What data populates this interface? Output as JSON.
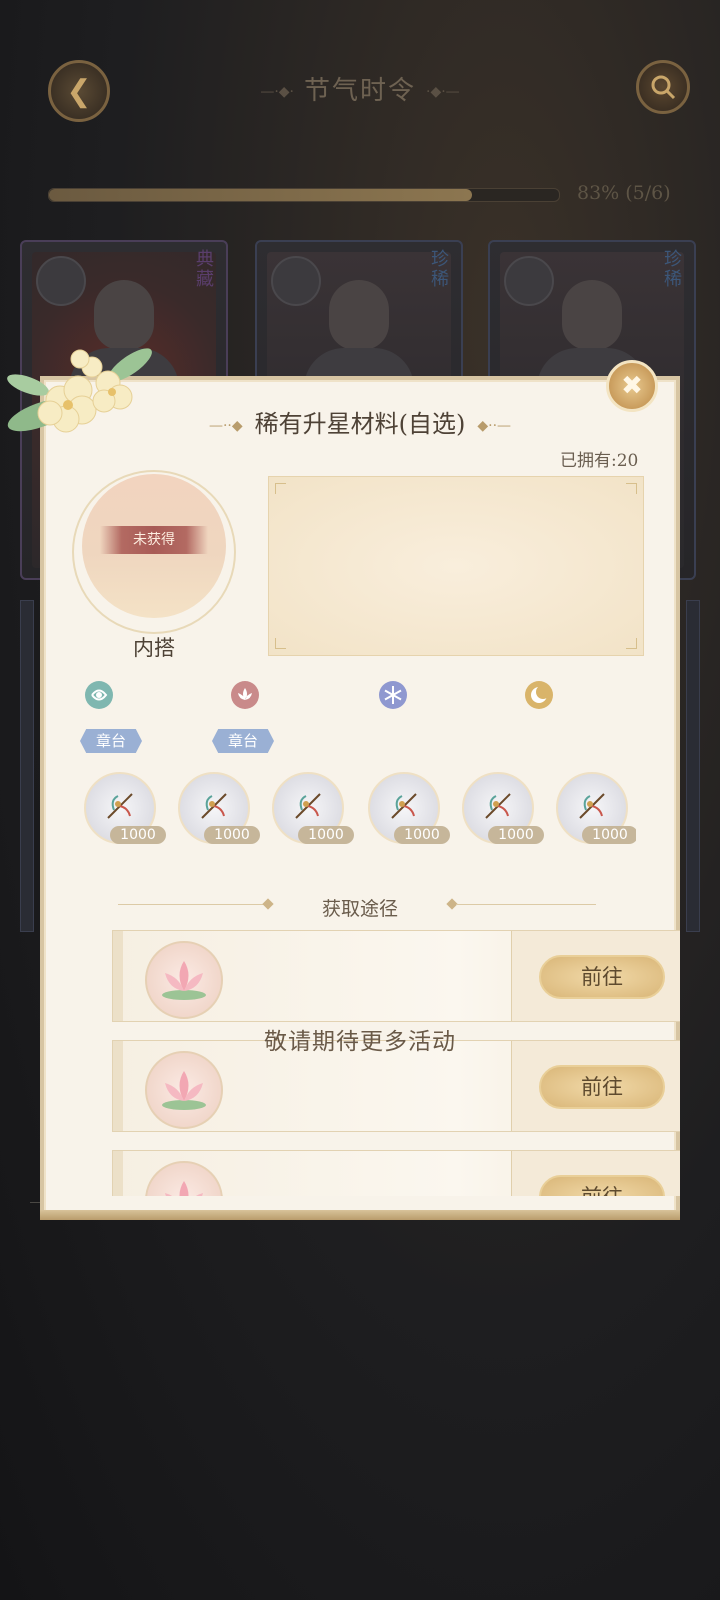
{
  "screen": {
    "title": "节气时令",
    "progress_text": "83% (5/6)",
    "progress_value": 0.83,
    "cards": [
      {
        "rarity": "典藏"
      },
      {
        "rarity": "珍稀"
      },
      {
        "rarity": "珍稀"
      }
    ]
  },
  "dialog": {
    "title": "稀有升星材料(自选)",
    "owned": "已拥有:20",
    "portrait": {
      "status": "未获得",
      "label": "内搭"
    },
    "elements": [
      {
        "icon": "wind-icon",
        "color": "#7fb7b0"
      },
      {
        "icon": "lotus-icon",
        "color": "#c98a8a"
      },
      {
        "icon": "snowflake-icon",
        "color": "#8f98d0"
      },
      {
        "icon": "moon-icon",
        "color": "#d9b46a"
      }
    ],
    "tags": [
      "章台",
      "章台"
    ],
    "items": [
      {
        "count": "1000"
      },
      {
        "count": "1000"
      },
      {
        "count": "1000"
      },
      {
        "count": "1000"
      },
      {
        "count": "1000"
      },
      {
        "count": "1000"
      }
    ],
    "section_title": "获取途径",
    "routes": [
      {
        "button": "前往"
      },
      {
        "button": "前往"
      },
      {
        "button": "前往"
      }
    ],
    "coming_soon": "敬请期待更多活动"
  }
}
